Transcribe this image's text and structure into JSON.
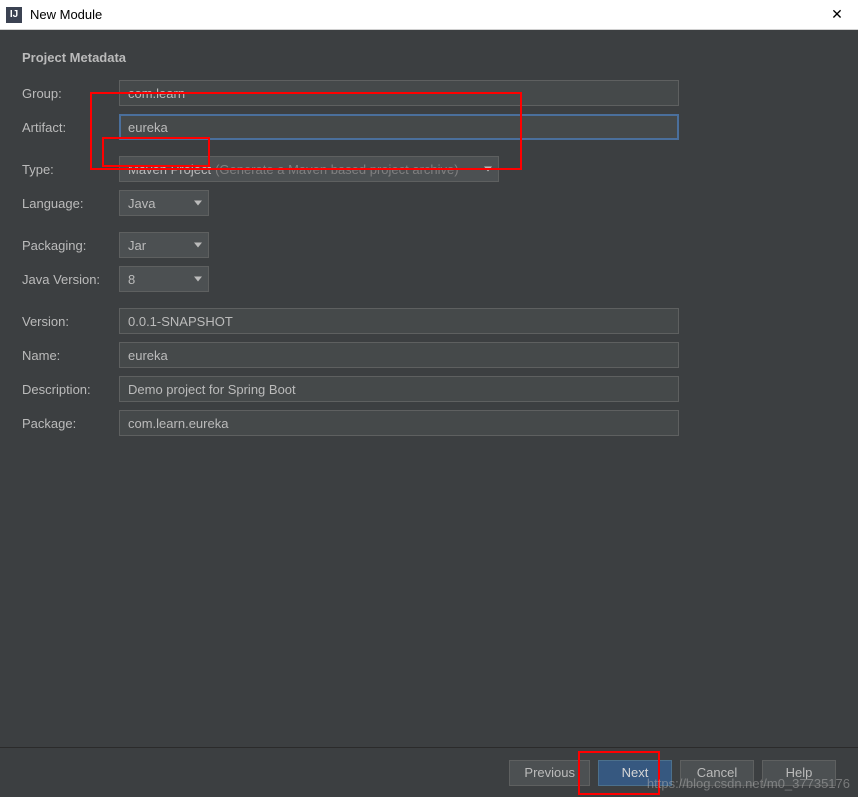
{
  "window": {
    "title": "New Module",
    "app_icon_letter": "IJ"
  },
  "heading": "Project Metadata",
  "labels": {
    "group": "Group:",
    "artifact": "Artifact:",
    "type": "Type:",
    "language": "Language:",
    "packaging": "Packaging:",
    "java_version": "Java Version:",
    "version": "Version:",
    "name": "Name:",
    "description": "Description:",
    "package": "Package:"
  },
  "values": {
    "group": "com.learn",
    "artifact": "eureka",
    "type": "Maven Project",
    "type_hint": "(Generate a Maven based project archive)",
    "language": "Java",
    "packaging": "Jar",
    "java_version": "8",
    "version": "0.0.1-SNAPSHOT",
    "name": "eureka",
    "description": "Demo project for Spring Boot",
    "package": "com.learn.eureka"
  },
  "buttons": {
    "previous": "Previous",
    "next": "Next",
    "cancel": "Cancel",
    "help": "Help"
  },
  "watermark": "https://blog.csdn.net/m0_37735176"
}
